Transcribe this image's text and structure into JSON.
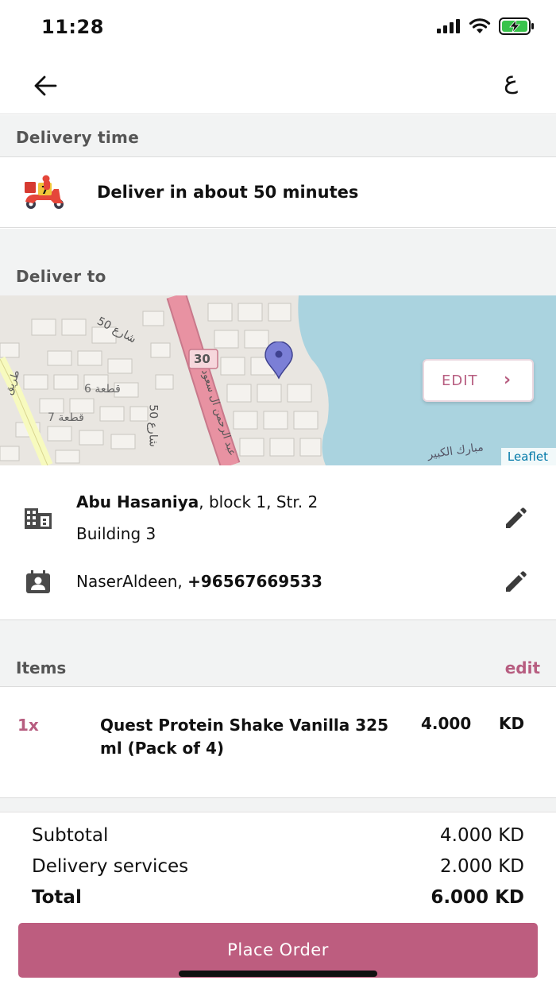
{
  "status_bar": {
    "time": "11:28"
  },
  "nav": {
    "lang_toggle": "ع"
  },
  "delivery_time": {
    "section_title": "Delivery time",
    "text": "Deliver in about 50 minutes"
  },
  "deliver_to": {
    "section_title": "Deliver to",
    "map": {
      "edit_label": "EDIT",
      "attribution": "Leaflet",
      "labels": {
        "road_number": "30",
        "block6": "قطعة 6",
        "block7": "قطعة 7",
        "street50": "شارع 50",
        "street50b": "شارع 50",
        "road_name": "عبد الرحمن ال سعود",
        "area": "مبارك الكبير",
        "road_side": "طريق"
      }
    },
    "address": {
      "area": "Abu Hasaniya",
      "rest": ", block 1, Str. 2",
      "building": "Building 3"
    },
    "contact": {
      "name": "NaserAldeen, ",
      "phone": "+96567669533"
    }
  },
  "items": {
    "section_title": "Items",
    "edit_label": "edit",
    "list": [
      {
        "qty": "1x",
        "name": "Quest Protein Shake Vanilla 325 ml (Pack of 4)",
        "price": "4.000",
        "currency": "KD"
      }
    ]
  },
  "totals": {
    "subtotal_label": "Subtotal",
    "subtotal_value": "4.000 KD",
    "delivery_label": "Delivery services",
    "delivery_value": "2.000 KD",
    "total_label": "Total",
    "total_value": "6.000 KD"
  },
  "actions": {
    "place_order": "Place Order"
  },
  "colors": {
    "accent": "#bd5d7f",
    "water": "#aad3df",
    "highway": "#e892a2",
    "secondary_road": "#f7fabf"
  }
}
